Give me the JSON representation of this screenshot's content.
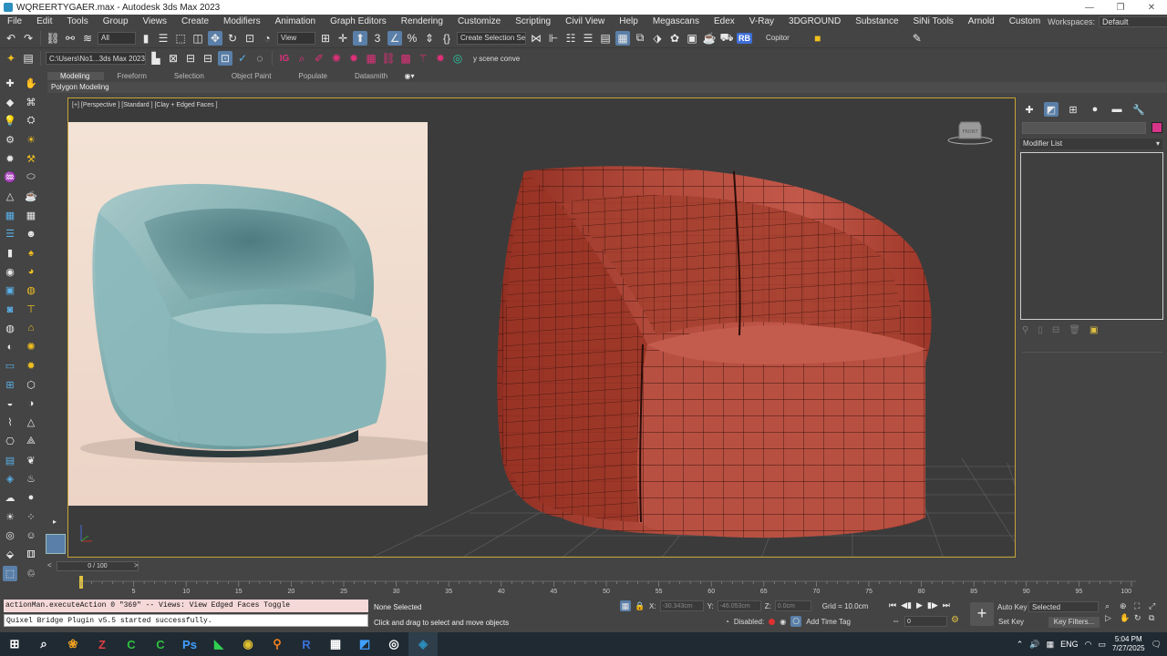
{
  "window": {
    "title": "WQREERTYGAER.max - Autodesk 3ds Max 2023",
    "controls": [
      "—",
      "❐",
      "✕"
    ]
  },
  "menu": {
    "items": [
      "File",
      "Edit",
      "Tools",
      "Group",
      "Views",
      "Create",
      "Modifiers",
      "Animation",
      "Graph Editors",
      "Rendering",
      "Customize",
      "Scripting",
      "Civil View",
      "Help",
      "Megascans",
      "Edex",
      "V-Ray",
      "3DGROUND",
      "Substance",
      "SiNi Tools",
      "Arnold",
      "Custom"
    ],
    "workspaces_label": "Workspaces:",
    "workspaces_value": "Default"
  },
  "toolbar1": {
    "filter": "All",
    "view": "View",
    "selection_set": "Create Selection Se",
    "copitor": "Copitor",
    "rb": "RB"
  },
  "toolbar2": {
    "project_path": "C:\\Users\\No1...3ds Max 2023",
    "script_text": "y scene conve",
    "ig_icon": "IG"
  },
  "ribbon": {
    "tabs": [
      "Modeling",
      "Freeform",
      "Selection",
      "Object Paint",
      "Populate",
      "Datasmith"
    ],
    "panel_label": "Polygon Modeling"
  },
  "viewport": {
    "label": "[+] [Perspective ] [Standard ] [Clay + Edged Faces ]",
    "viewcube_label": "FRONT"
  },
  "command_panel": {
    "modifier_list": "Modifier List",
    "object_color": "#d8348a"
  },
  "timeline": {
    "frame_display": "0 / 100",
    "ticks": [
      "5",
      "10",
      "15",
      "20",
      "25",
      "30",
      "35",
      "40",
      "45",
      "50",
      "55",
      "60",
      "65",
      "70",
      "75",
      "80",
      "85",
      "90",
      "95",
      "100"
    ]
  },
  "listener": {
    "line1": "actionMan.executeAction 0 \"369\"  -- Views: View Edged Faces Toggle",
    "line2": "Quixel Bridge Plugin v5.5 started successfully."
  },
  "status": {
    "selection": "None Selected",
    "prompt": "Click and drag to select and move objects",
    "x_label": "X:",
    "x_value": "-30.343cm",
    "y_label": "Y:",
    "y_value": "-46.053cm",
    "z_label": "Z:",
    "z_value": "0.0cm",
    "grid": "Grid = 10.0cm",
    "disabled_label": "Disabled:",
    "add_time_tag": "Add Time Tag",
    "frame_value": "0",
    "auto_key": "Auto Key",
    "set_key": "Set Key",
    "selected_dd": "Selected",
    "key_filters": "Key Filters..."
  },
  "taskbar": {
    "tray_lang": "ENG",
    "time": "5:04 PM",
    "date": "7/27/2025"
  }
}
